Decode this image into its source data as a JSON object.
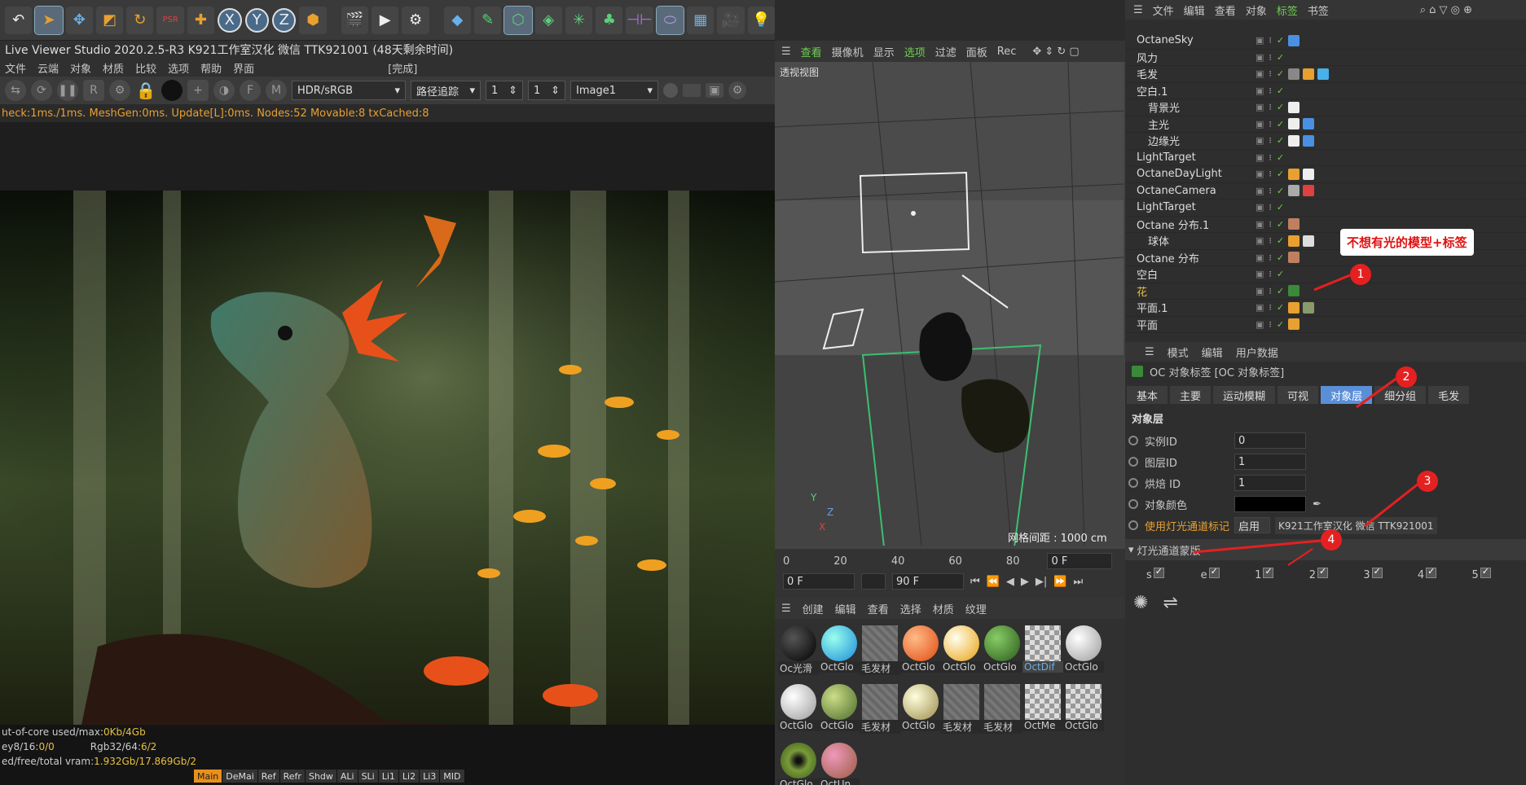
{
  "toolbar": {
    "icons": [
      "undo-icon",
      "cursor-icon",
      "move-icon",
      "scale-icon",
      "rotate-icon",
      "psr-icon",
      "add-icon",
      "x-axis-icon",
      "y-axis-icon",
      "z-axis-icon",
      "coord-icon",
      "render-view-icon",
      "render-icon",
      "render-settings-icon",
      "cube-icon",
      "pen-icon",
      "subdivide-icon",
      "extrude-icon",
      "mograph-icon",
      "cloner-icon",
      "deformer-icon",
      "environment-icon",
      "floor-icon",
      "camera-icon",
      "light-icon"
    ],
    "axis_labels": [
      "X",
      "Y",
      "Z"
    ],
    "psr": "PSR"
  },
  "live_viewer": {
    "title": "Live Viewer Studio 2020.2.5-R3  K921工作室汉化  微信  TTK921001   (48天剩余时间)",
    "menu": [
      "文件",
      "云端",
      "对象",
      "材质",
      "比较",
      "选项",
      "帮助",
      "界面"
    ],
    "menu_status": "[完成]",
    "tools": {
      "color_space": "HDR/sRGB",
      "trace": "路径追踪",
      "val1": "1",
      "val2": "1",
      "image": "Image1"
    },
    "status_line": "heck:1ms./1ms. MeshGen:0ms. Update[L]:0ms. Nodes:52 Movable:8 txCached:8",
    "bottom": {
      "line1_label": "ut-of-core used/max:",
      "line1_val": "0Kb/4Gb",
      "line2a_label": "ey8/16: ",
      "line2a_val": "0/0",
      "line2b_label": "Rgb32/64: ",
      "line2b_val": "6/2",
      "line3_label": "ed/free/total vram: ",
      "line3_val": "1.932Gb/17.869Gb/2",
      "chips": [
        "Main",
        "DeMai",
        "Ref",
        "Refr",
        "Shdw",
        "ALi",
        "SLi",
        "Li1",
        "Li2",
        "Li3",
        "MID"
      ]
    }
  },
  "viewport": {
    "menu": [
      "查看",
      "摄像机",
      "显示",
      "选项",
      "过滤",
      "面板",
      "Rec"
    ],
    "label": "透视视图",
    "grid": "网格间距 : 1000 cm",
    "axes": [
      "Y",
      "Z",
      "X"
    ]
  },
  "timeline": {
    "ticks": [
      "0",
      "20",
      "40",
      "60",
      "80"
    ],
    "frame": "0 F",
    "start": "0 F",
    "end": "90 F"
  },
  "material": {
    "menu": [
      "创建",
      "编辑",
      "查看",
      "选择",
      "材质",
      "纹理"
    ],
    "items": [
      {
        "label": "Oc光滑",
        "kind": "black"
      },
      {
        "label": "OctGlo",
        "kind": "blue"
      },
      {
        "label": "毛发材",
        "kind": "stripe"
      },
      {
        "label": "OctGlo",
        "kind": "orange"
      },
      {
        "label": "OctGlo",
        "kind": "yellow"
      },
      {
        "label": "OctGlo",
        "kind": "green"
      },
      {
        "label": "OctDif",
        "kind": "checker",
        "sel": true
      },
      {
        "label": "OctGlo",
        "kind": "white"
      },
      {
        "label": "OctGlo",
        "kind": "white"
      },
      {
        "label": "OctGlo",
        "kind": "lime"
      },
      {
        "label": "毛发材",
        "kind": "stripe"
      },
      {
        "label": "OctGlo",
        "kind": "khaki"
      },
      {
        "label": "毛发材",
        "kind": "stripe"
      },
      {
        "label": "毛发材",
        "kind": "stripe"
      },
      {
        "label": "OctMe",
        "kind": "checker"
      },
      {
        "label": "OctGlo",
        "kind": "checker"
      },
      {
        "label": "OctGlo",
        "kind": "eye"
      },
      {
        "label": "OctUn",
        "kind": "skin"
      }
    ]
  },
  "object_manager": {
    "menu": [
      "文件",
      "编辑",
      "查看",
      "对象",
      "标签",
      "书签"
    ],
    "rows": [
      {
        "name": "OctaneSky",
        "indent": 0,
        "tags": [
          "#4a90e2"
        ]
      },
      {
        "name": "风力",
        "indent": 0,
        "tags": []
      },
      {
        "name": "毛发",
        "indent": 0,
        "tags": [
          "#888",
          "#e8a030",
          "#4ab0e8"
        ]
      },
      {
        "name": "空白.1",
        "indent": 0,
        "tags": []
      },
      {
        "name": "背景光",
        "indent": 1,
        "tags": [
          "#eee"
        ]
      },
      {
        "name": "主光",
        "indent": 1,
        "tags": [
          "#eee",
          "#4a90e2"
        ]
      },
      {
        "name": "边缘光",
        "indent": 1,
        "tags": [
          "#eee",
          "#4a90e2"
        ]
      },
      {
        "name": "LightTarget",
        "indent": 0,
        "tags": []
      },
      {
        "name": "OctaneDayLight",
        "indent": 0,
        "tags": [
          "#e8a030",
          "#eee"
        ]
      },
      {
        "name": "OctaneCamera",
        "indent": 0,
        "tags": [
          "#aaa",
          "#e04040"
        ]
      },
      {
        "name": "LightTarget",
        "indent": 0,
        "tags": []
      },
      {
        "name": "Octane 分布.1",
        "indent": 0,
        "tags": [
          "#c08060"
        ]
      },
      {
        "name": "球体",
        "indent": 1,
        "tags": [
          "#e8a030",
          "#ddd"
        ]
      },
      {
        "name": "Octane 分布",
        "indent": 0,
        "tags": [
          "#c08060"
        ]
      },
      {
        "name": "空白",
        "indent": 0,
        "tags": []
      },
      {
        "name": "花",
        "indent": 0,
        "tags": [
          "#3a8a3a"
        ],
        "orange": true
      },
      {
        "name": "平面.1",
        "indent": 0,
        "tags": [
          "#e8a030",
          "#8a9a6a"
        ]
      },
      {
        "name": "平面",
        "indent": 0,
        "tags": [
          "#e8a030"
        ]
      }
    ]
  },
  "callout": "不想有光的模型+标签",
  "annotations": [
    "1",
    "2",
    "3",
    "4"
  ],
  "attributes": {
    "menu": [
      "模式",
      "编辑",
      "用户数据"
    ],
    "header": "OC 对象标签 [OC 对象标签]",
    "tabs": [
      "基本",
      "主要",
      "运动模糊",
      "可视",
      "对象层",
      "细分组",
      "毛发"
    ],
    "active_tab": "对象层",
    "section": "对象层",
    "fields": [
      {
        "label": "实例ID",
        "value": "0"
      },
      {
        "label": "图层ID",
        "value": "1"
      },
      {
        "label": "烘焙 ID",
        "value": "1"
      }
    ],
    "color_label": "对象颜色",
    "light_pass_label": "使用灯光通道标记",
    "light_pass_value": "启用",
    "light_pass_extra": "K921工作室汉化 微信 TTK921001",
    "mask_label": "灯光通道蒙版",
    "mask_items": [
      "s",
      "e",
      "1",
      "2",
      "3",
      "4",
      "5"
    ]
  }
}
